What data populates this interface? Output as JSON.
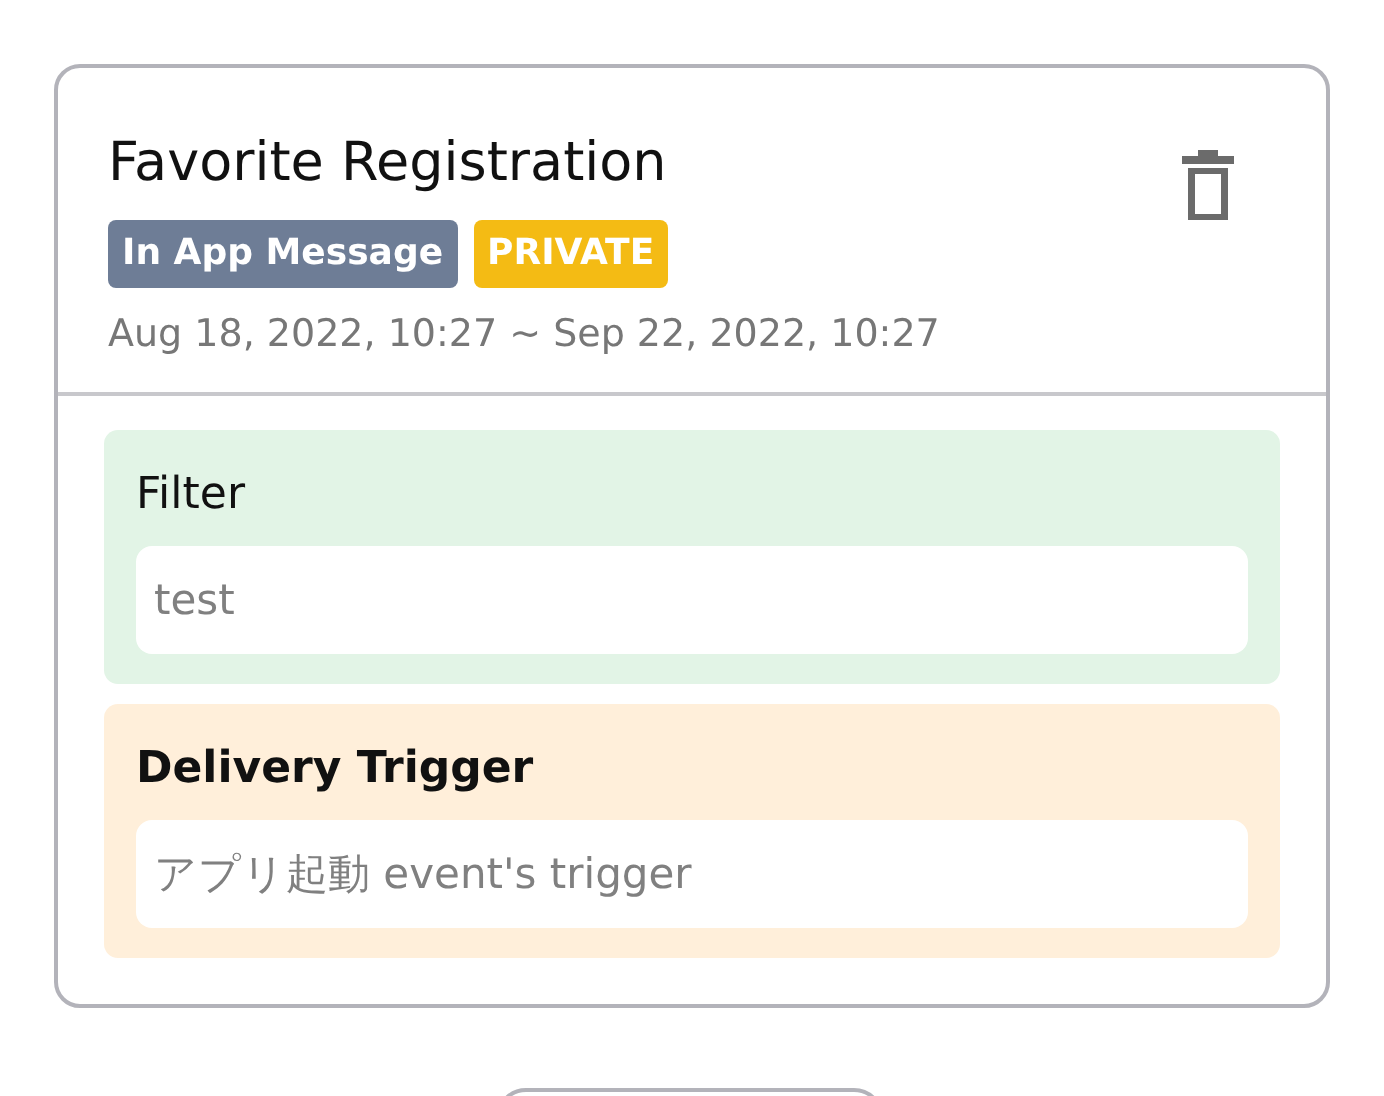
{
  "card": {
    "title": "Favorite Registration",
    "badges": [
      {
        "label": "In App Message",
        "color": "#6e7d96"
      },
      {
        "label": "PRIVATE",
        "color": "#f4bb14"
      }
    ],
    "period": "Aug 18, 2022, 10:27 ~ Sep 22, 2022, 10:27",
    "sections": [
      {
        "kind": "filter",
        "label": "Filter",
        "value": "test"
      },
      {
        "kind": "trigger",
        "label": "Delivery Trigger",
        "value": "アプリ起動 event's trigger"
      }
    ]
  }
}
